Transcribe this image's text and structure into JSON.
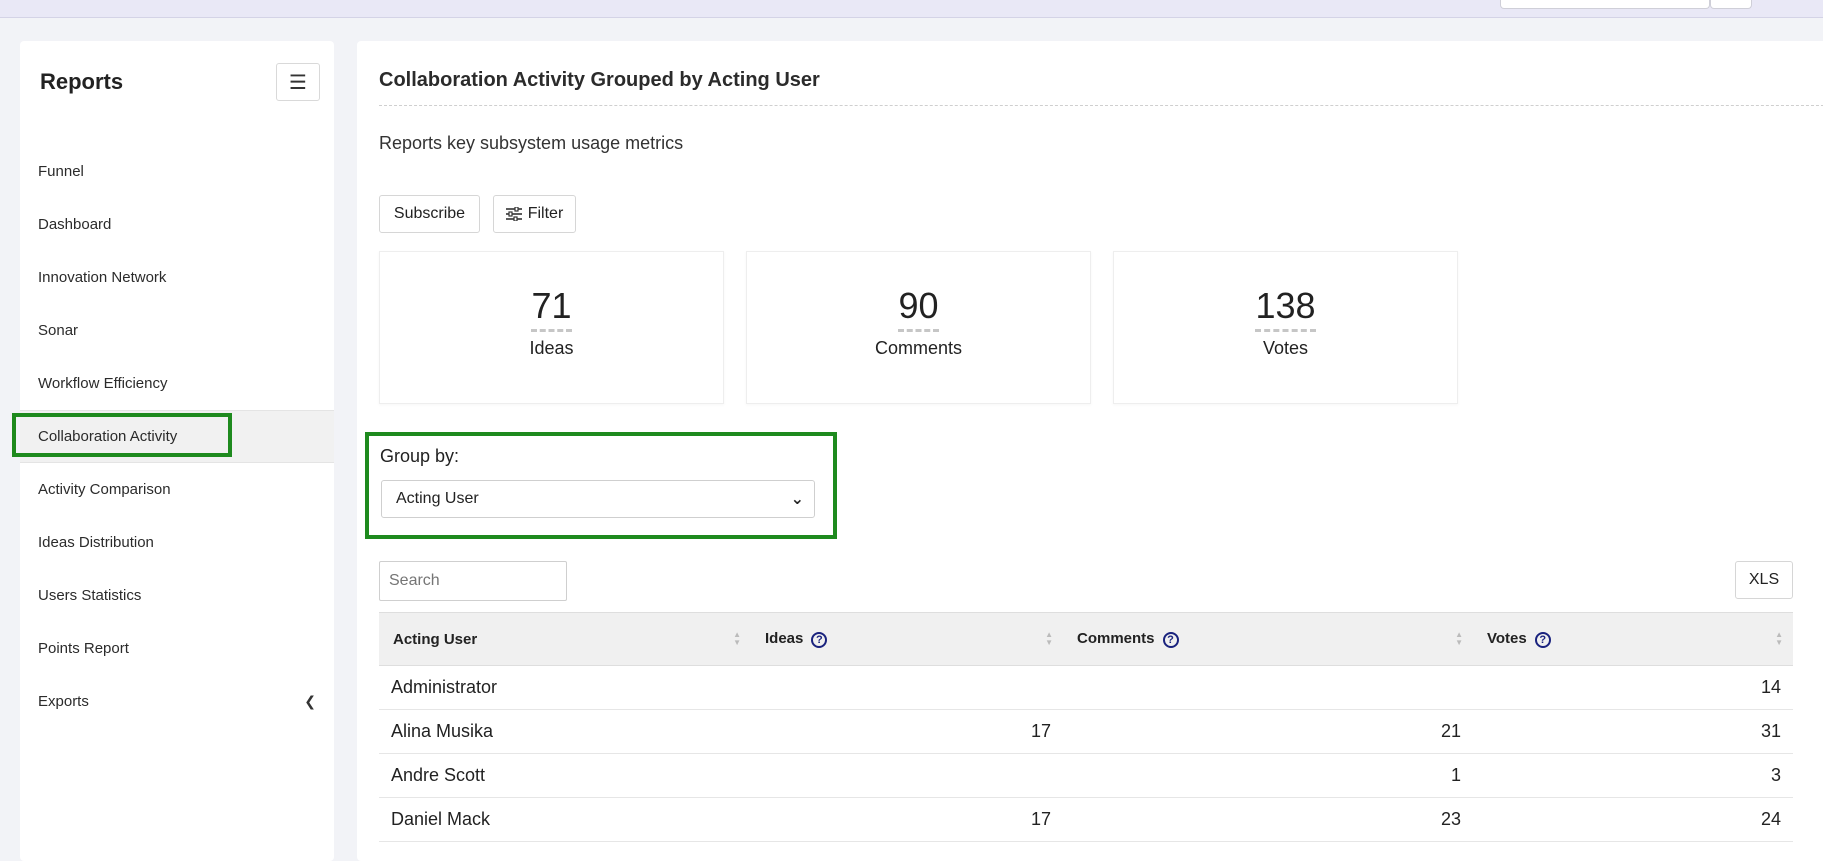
{
  "sidebar": {
    "title": "Reports",
    "menu_icon": "hamburger-icon",
    "items": [
      {
        "label": "Funnel",
        "key": "funnel"
      },
      {
        "label": "Dashboard",
        "key": "dashboard"
      },
      {
        "label": "Innovation Network",
        "key": "innovation-network"
      },
      {
        "label": "Sonar",
        "key": "sonar"
      },
      {
        "label": "Workflow Efficiency",
        "key": "workflow-efficiency"
      },
      {
        "label": "Collaboration Activity",
        "key": "collaboration-activity",
        "active": true
      },
      {
        "label": "Activity Comparison",
        "key": "activity-comparison"
      },
      {
        "label": "Ideas Distribution",
        "key": "ideas-distribution"
      },
      {
        "label": "Users Statistics",
        "key": "users-statistics"
      },
      {
        "label": "Points Report",
        "key": "points-report"
      },
      {
        "label": "Exports",
        "key": "exports",
        "expandable": true
      }
    ]
  },
  "main": {
    "title": "Collaboration Activity Grouped by Acting User",
    "subtitle": "Reports key subsystem usage metrics",
    "subscribe_label": "Subscribe",
    "filter_label": "Filter",
    "stats": [
      {
        "value": "71",
        "label": "Ideas"
      },
      {
        "value": "90",
        "label": "Comments"
      },
      {
        "value": "138",
        "label": "Votes"
      }
    ],
    "group_by": {
      "label": "Group by:",
      "selected": "Acting User"
    },
    "search": {
      "placeholder": "Search"
    },
    "xls_label": "XLS",
    "table": {
      "headers": [
        "Acting User",
        "Ideas",
        "Comments",
        "Votes"
      ],
      "rows": [
        {
          "name": "Administrator",
          "ideas": "",
          "comments": "",
          "votes": "14"
        },
        {
          "name": "Alina Musika",
          "ideas": "17",
          "comments": "21",
          "votes": "31"
        },
        {
          "name": "Andre Scott",
          "ideas": "",
          "comments": "1",
          "votes": "3"
        },
        {
          "name": "Daniel Mack",
          "ideas": "17",
          "comments": "23",
          "votes": "24"
        }
      ]
    }
  },
  "colors": {
    "highlight": "#1e8a1e",
    "help_icon": "#1a237e"
  }
}
